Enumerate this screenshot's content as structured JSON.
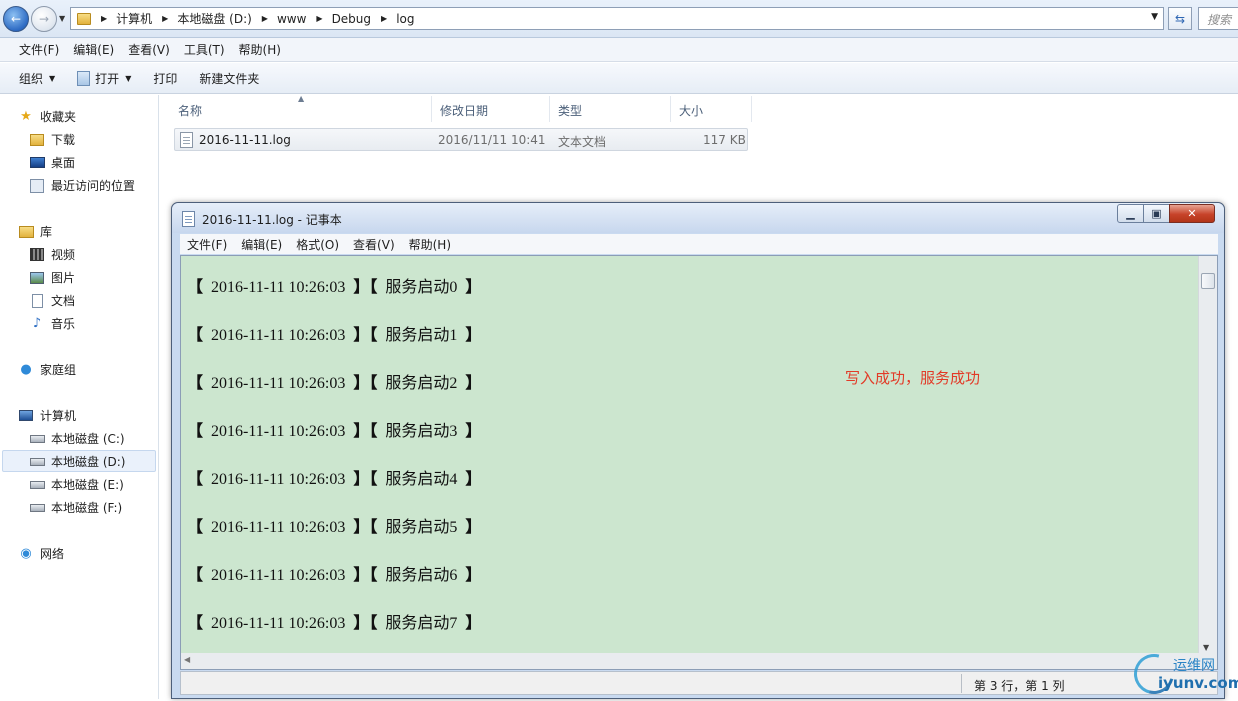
{
  "explorer": {
    "breadcrumb": [
      "计算机",
      "本地磁盘 (D:)",
      "www",
      "Debug",
      "log"
    ],
    "search_placeholder": "搜索",
    "menu": [
      "文件(F)",
      "编辑(E)",
      "查看(V)",
      "工具(T)",
      "帮助(H)"
    ],
    "commands": {
      "organize": "组织",
      "open": "打开",
      "print": "打印",
      "new_folder": "新建文件夹"
    },
    "nav": {
      "favorites": "收藏夹",
      "downloads": "下载",
      "desktop": "桌面",
      "recent": "最近访问的位置",
      "libraries": "库",
      "videos": "视频",
      "pictures": "图片",
      "documents": "文档",
      "music": "音乐",
      "homegroup": "家庭组",
      "computer": "计算机",
      "drive_c": "本地磁盘 (C:)",
      "drive_d": "本地磁盘 (D:)",
      "drive_e": "本地磁盘 (E:)",
      "drive_f": "本地磁盘 (F:)",
      "network": "网络"
    },
    "columns": {
      "name": "名称",
      "modified": "修改日期",
      "type": "类型",
      "size": "大小"
    },
    "file": {
      "name": "2016-11-11.log",
      "modified": "2016/11/11 10:41",
      "type": "文本文档",
      "size": "117 KB"
    }
  },
  "notepad": {
    "title": "2016-11-11.log - 记事本",
    "menu": [
      "文件(F)",
      "编辑(E)",
      "格式(O)",
      "查看(V)",
      "帮助(H)"
    ],
    "lines": [
      {
        "timestamp": "2016-11-11 10:26:03",
        "message": "服务启动0"
      },
      {
        "timestamp": "2016-11-11 10:26:03",
        "message": "服务启动1"
      },
      {
        "timestamp": "2016-11-11 10:26:03",
        "message": "服务启动2"
      },
      {
        "timestamp": "2016-11-11 10:26:03",
        "message": "服务启动3"
      },
      {
        "timestamp": "2016-11-11 10:26:03",
        "message": "服务启动4"
      },
      {
        "timestamp": "2016-11-11 10:26:03",
        "message": "服务启动5"
      },
      {
        "timestamp": "2016-11-11 10:26:03",
        "message": "服务启动6"
      },
      {
        "timestamp": "2016-11-11 10:26:03",
        "message": "服务启动7"
      }
    ],
    "annotation": "写入成功，服务成功",
    "status": "第 3 行，第 1 列",
    "editor_background": "#cce6cf",
    "annotation_color": "#e23a27"
  },
  "watermark": {
    "cn": "运维网",
    "en": "iyunv.com"
  }
}
